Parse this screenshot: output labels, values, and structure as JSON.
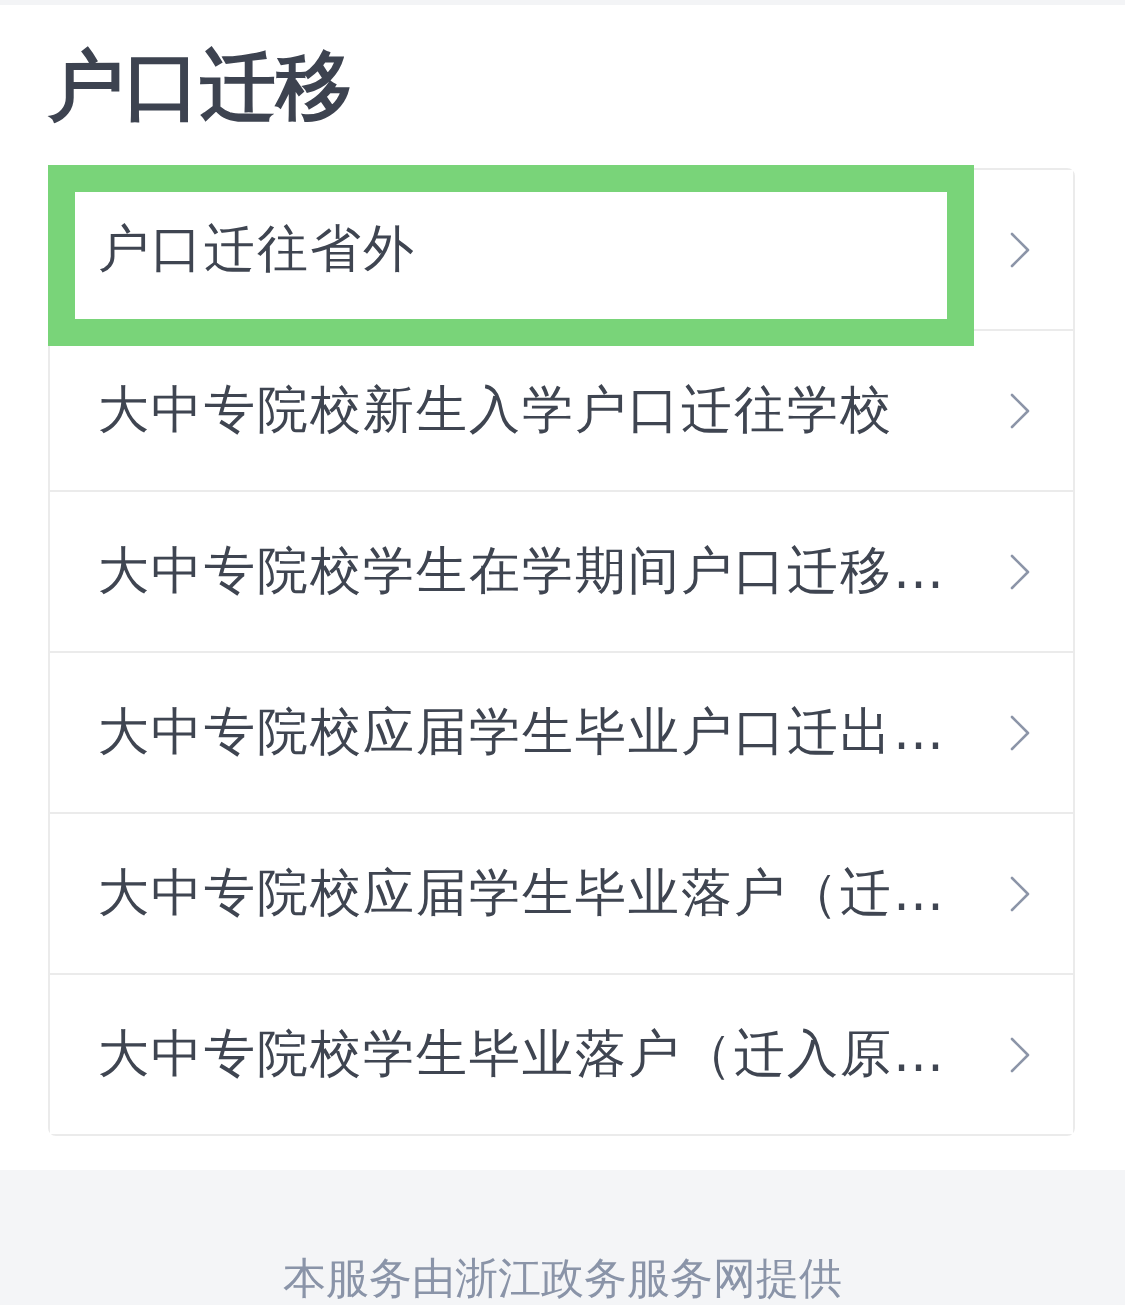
{
  "page": {
    "title": "户口迁移"
  },
  "items": [
    {
      "label": "户口迁往省外",
      "highlighted": true
    },
    {
      "label": "大中专院校新生入学户口迁往学校",
      "highlighted": false
    },
    {
      "label": "大中专院校学生在学期间户口迁移…",
      "highlighted": false
    },
    {
      "label": "大中专院校应届学生毕业户口迁出…",
      "highlighted": false
    },
    {
      "label": "大中专院校应届学生毕业落户（迁…",
      "highlighted": false
    },
    {
      "label": "大中专院校学生毕业落户（迁入原…",
      "highlighted": false
    }
  ],
  "footer": {
    "text": "本服务由浙江政务服务网提供"
  }
}
